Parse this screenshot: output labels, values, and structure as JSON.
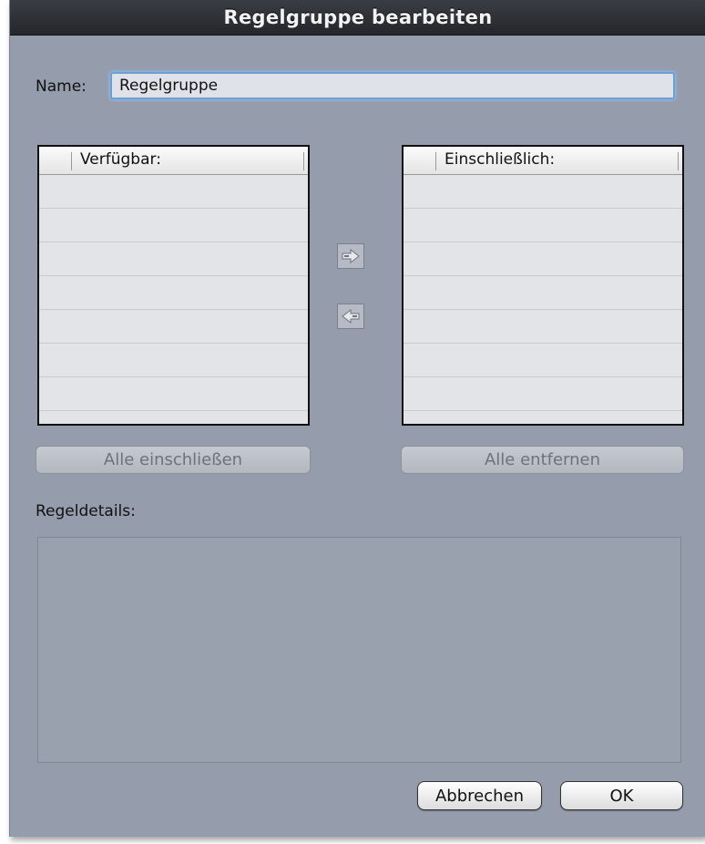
{
  "window": {
    "title": "Regelgruppe bearbeiten"
  },
  "name_field": {
    "label": "Name:",
    "value": "Regelgruppe"
  },
  "available_list": {
    "header": "Verfügbar:",
    "items": []
  },
  "included_list": {
    "header": "Einschließlich:",
    "items": []
  },
  "move_buttons": {
    "add_icon": "arrow-right-icon",
    "remove_icon": "arrow-left-icon"
  },
  "buttons": {
    "include_all": "Alle einschließen",
    "remove_all": "Alle entfernen",
    "cancel": "Abbrechen",
    "ok": "OK"
  },
  "details": {
    "label": "Regeldetails:",
    "content": ""
  }
}
